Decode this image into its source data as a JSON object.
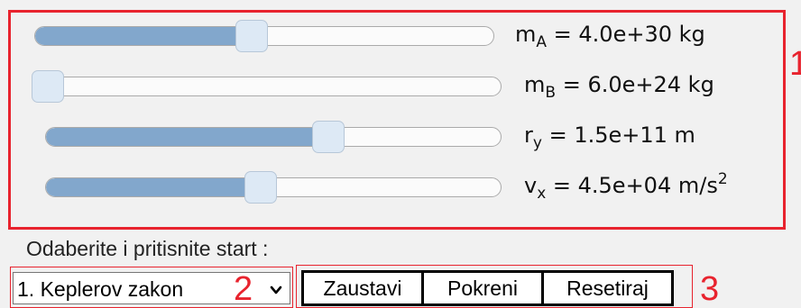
{
  "sliders": [
    {
      "name": "m_A",
      "symbol": "m",
      "sub": "A",
      "value": "4.0e+30",
      "unit": "kg",
      "unit_sup": "",
      "position": 0.47
    },
    {
      "name": "m_B",
      "symbol": "m",
      "sub": "B",
      "value": "6.0e+24",
      "unit": "kg",
      "unit_sup": "",
      "position": 0.0
    },
    {
      "name": "r_y",
      "symbol": "r",
      "sub": "y",
      "value": "1.5e+11",
      "unit": "m",
      "unit_sup": "",
      "position": 0.63
    },
    {
      "name": "v_x",
      "symbol": "v",
      "sub": "x",
      "value": "4.5e+04",
      "unit": "m/s",
      "unit_sup": "2",
      "position": 0.47
    }
  ],
  "controls": {
    "prompt": "Odaberite i pritisnite start :",
    "select_value": "1. Keplerov zakon",
    "stop_label": "Zaustavi",
    "start_label": "Pokreni",
    "reset_label": "Resetiraj"
  },
  "annotations": {
    "one": "1",
    "two": "2",
    "three": "3",
    "color": "#e8232e"
  },
  "colors": {
    "slider_fill": "#82a7cc",
    "slider_thumb": "#dde9f5",
    "background": "#f1f1f1"
  }
}
